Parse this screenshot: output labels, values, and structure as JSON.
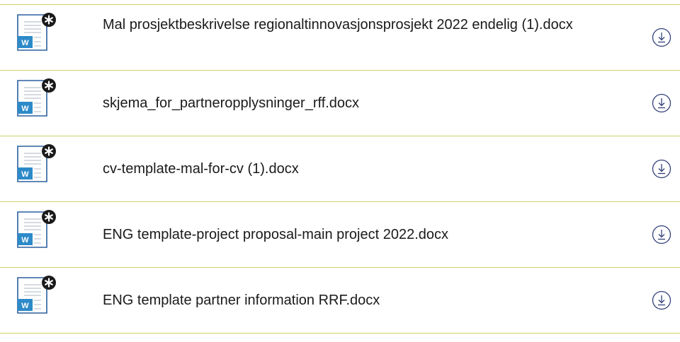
{
  "colors": {
    "divider": "#cfd46a",
    "icon_blue": "#2a5f9e",
    "icon_badge": "#2d8ac9",
    "download_icon": "#33407a"
  },
  "files": [
    {
      "name": "Mal prosjektbeskrivelse regionaltinnovasjonsprosjekt 2022 endelig (1).docx",
      "file_icon": "word-document-icon",
      "badge_icon": "asterisk-badge-icon",
      "badge_letter": "W",
      "action_icon": "download-icon"
    },
    {
      "name": "skjema_for_partneropplysninger_rff.docx",
      "file_icon": "word-document-icon",
      "badge_icon": "asterisk-badge-icon",
      "badge_letter": "W",
      "action_icon": "download-icon"
    },
    {
      "name": "cv-template-mal-for-cv (1).docx",
      "file_icon": "word-document-icon",
      "badge_icon": "asterisk-badge-icon",
      "badge_letter": "W",
      "action_icon": "download-icon"
    },
    {
      "name": "ENG template-project proposal-main project 2022.docx",
      "file_icon": "word-document-icon",
      "badge_icon": "asterisk-badge-icon",
      "badge_letter": "W",
      "action_icon": "download-icon"
    },
    {
      "name": "ENG template partner information RRF.docx",
      "file_icon": "word-document-icon",
      "badge_icon": "asterisk-badge-icon",
      "badge_letter": "W",
      "action_icon": "download-icon"
    }
  ]
}
